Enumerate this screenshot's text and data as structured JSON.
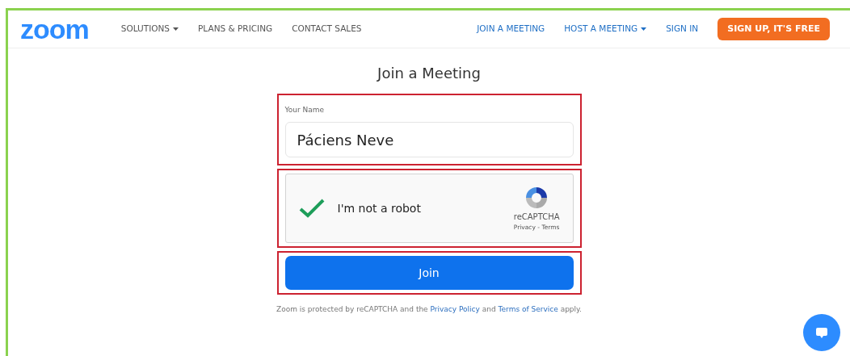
{
  "navbar": {
    "logo": "zoom",
    "left_links": [
      {
        "label": "SOLUTIONS",
        "dropdown": true
      },
      {
        "label": "PLANS & PRICING",
        "dropdown": false
      },
      {
        "label": "CONTACT SALES",
        "dropdown": false
      }
    ],
    "right_links": [
      {
        "label": "JOIN A MEETING",
        "dropdown": false
      },
      {
        "label": "HOST A MEETING",
        "dropdown": true
      },
      {
        "label": "SIGN IN",
        "dropdown": false
      }
    ],
    "signup_button": "SIGN UP, IT'S FREE"
  },
  "form": {
    "title": "Join a Meeting",
    "name_label": "Your Name",
    "name_value": "Páciens Neve",
    "recaptcha": {
      "checked": true,
      "label": "I'm not a robot",
      "brand": "reCAPTCHA",
      "links": "Privacy - Terms"
    },
    "join_button": "Join",
    "notice": [
      {
        "kind": "text",
        "text": "Zoom is protected by reCAPTCHA and the"
      },
      {
        "kind": "link",
        "text": "Privacy Policy"
      },
      {
        "kind": "text",
        "text": "and"
      },
      {
        "kind": "link",
        "text": "Terms of Service"
      },
      {
        "kind": "text",
        "text": "apply."
      }
    ]
  }
}
